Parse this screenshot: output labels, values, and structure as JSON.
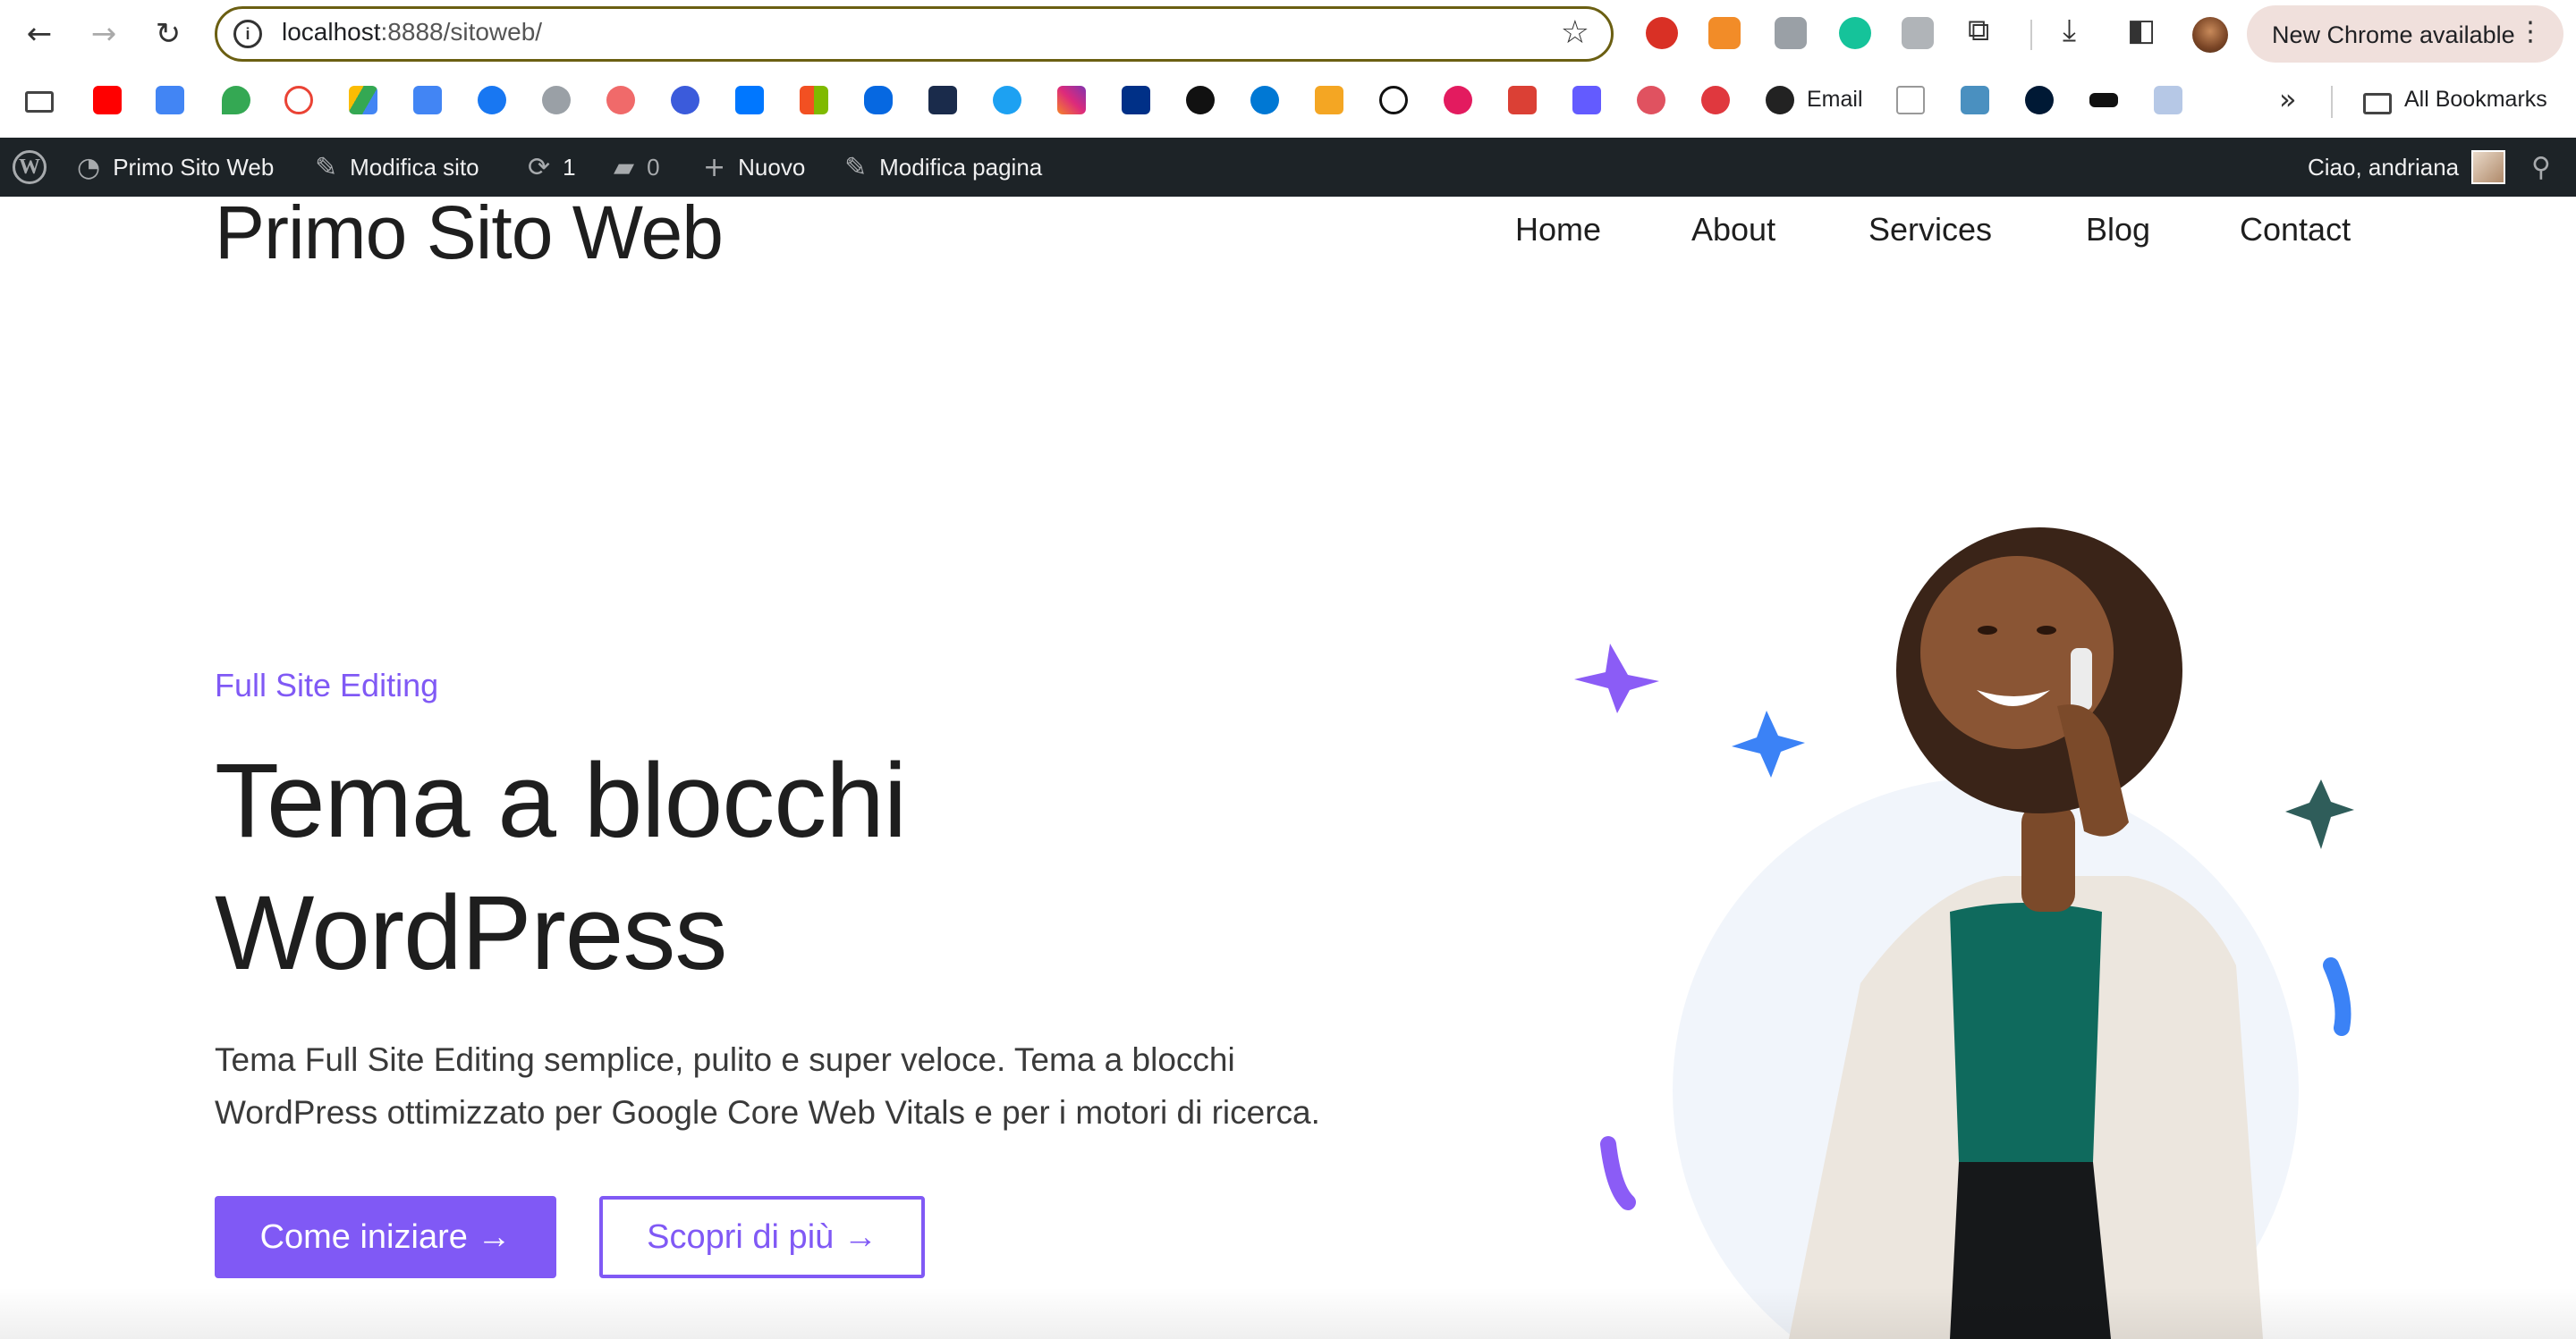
{
  "browser": {
    "url_host": "localhost",
    "url_rest": ":8888/sitoweb/",
    "update_label": "New Chrome available"
  },
  "bookmarks": {
    "email_label": "Email",
    "all_bookmarks_label": "All Bookmarks"
  },
  "admin_bar": {
    "site_name": "Primo Sito Web",
    "customize": "Modifica sito",
    "updates_count": "1",
    "comments_count": "0",
    "new_label": "Nuovo",
    "edit_page": "Modifica pagina",
    "greeting": "Ciao, andriana"
  },
  "site": {
    "title": "Primo Sito Web",
    "nav": [
      "Home",
      "About",
      "Services",
      "Blog",
      "Contact"
    ]
  },
  "hero": {
    "kicker": "Full Site Editing",
    "title_line1": "Tema a blocchi",
    "title_line2": "WordPress",
    "desc_line1": "Tema Full Site Editing semplice, pulito e super veloce. Tema a blocchi",
    "desc_line2": "WordPress ottimizzato per Google Core Web Vitals e per i motori di ricerca.",
    "cta_primary": "Come iniziare →",
    "cta_secondary": "Scopri di più →"
  },
  "colors": {
    "accent": "#8059f5",
    "admin_bar_bg": "#1d2327",
    "star_purple": "#8b5cf6",
    "star_blue": "#3b82f6",
    "star_teal": "#2f5d5a",
    "circle_bg": "#f1f5fb"
  }
}
